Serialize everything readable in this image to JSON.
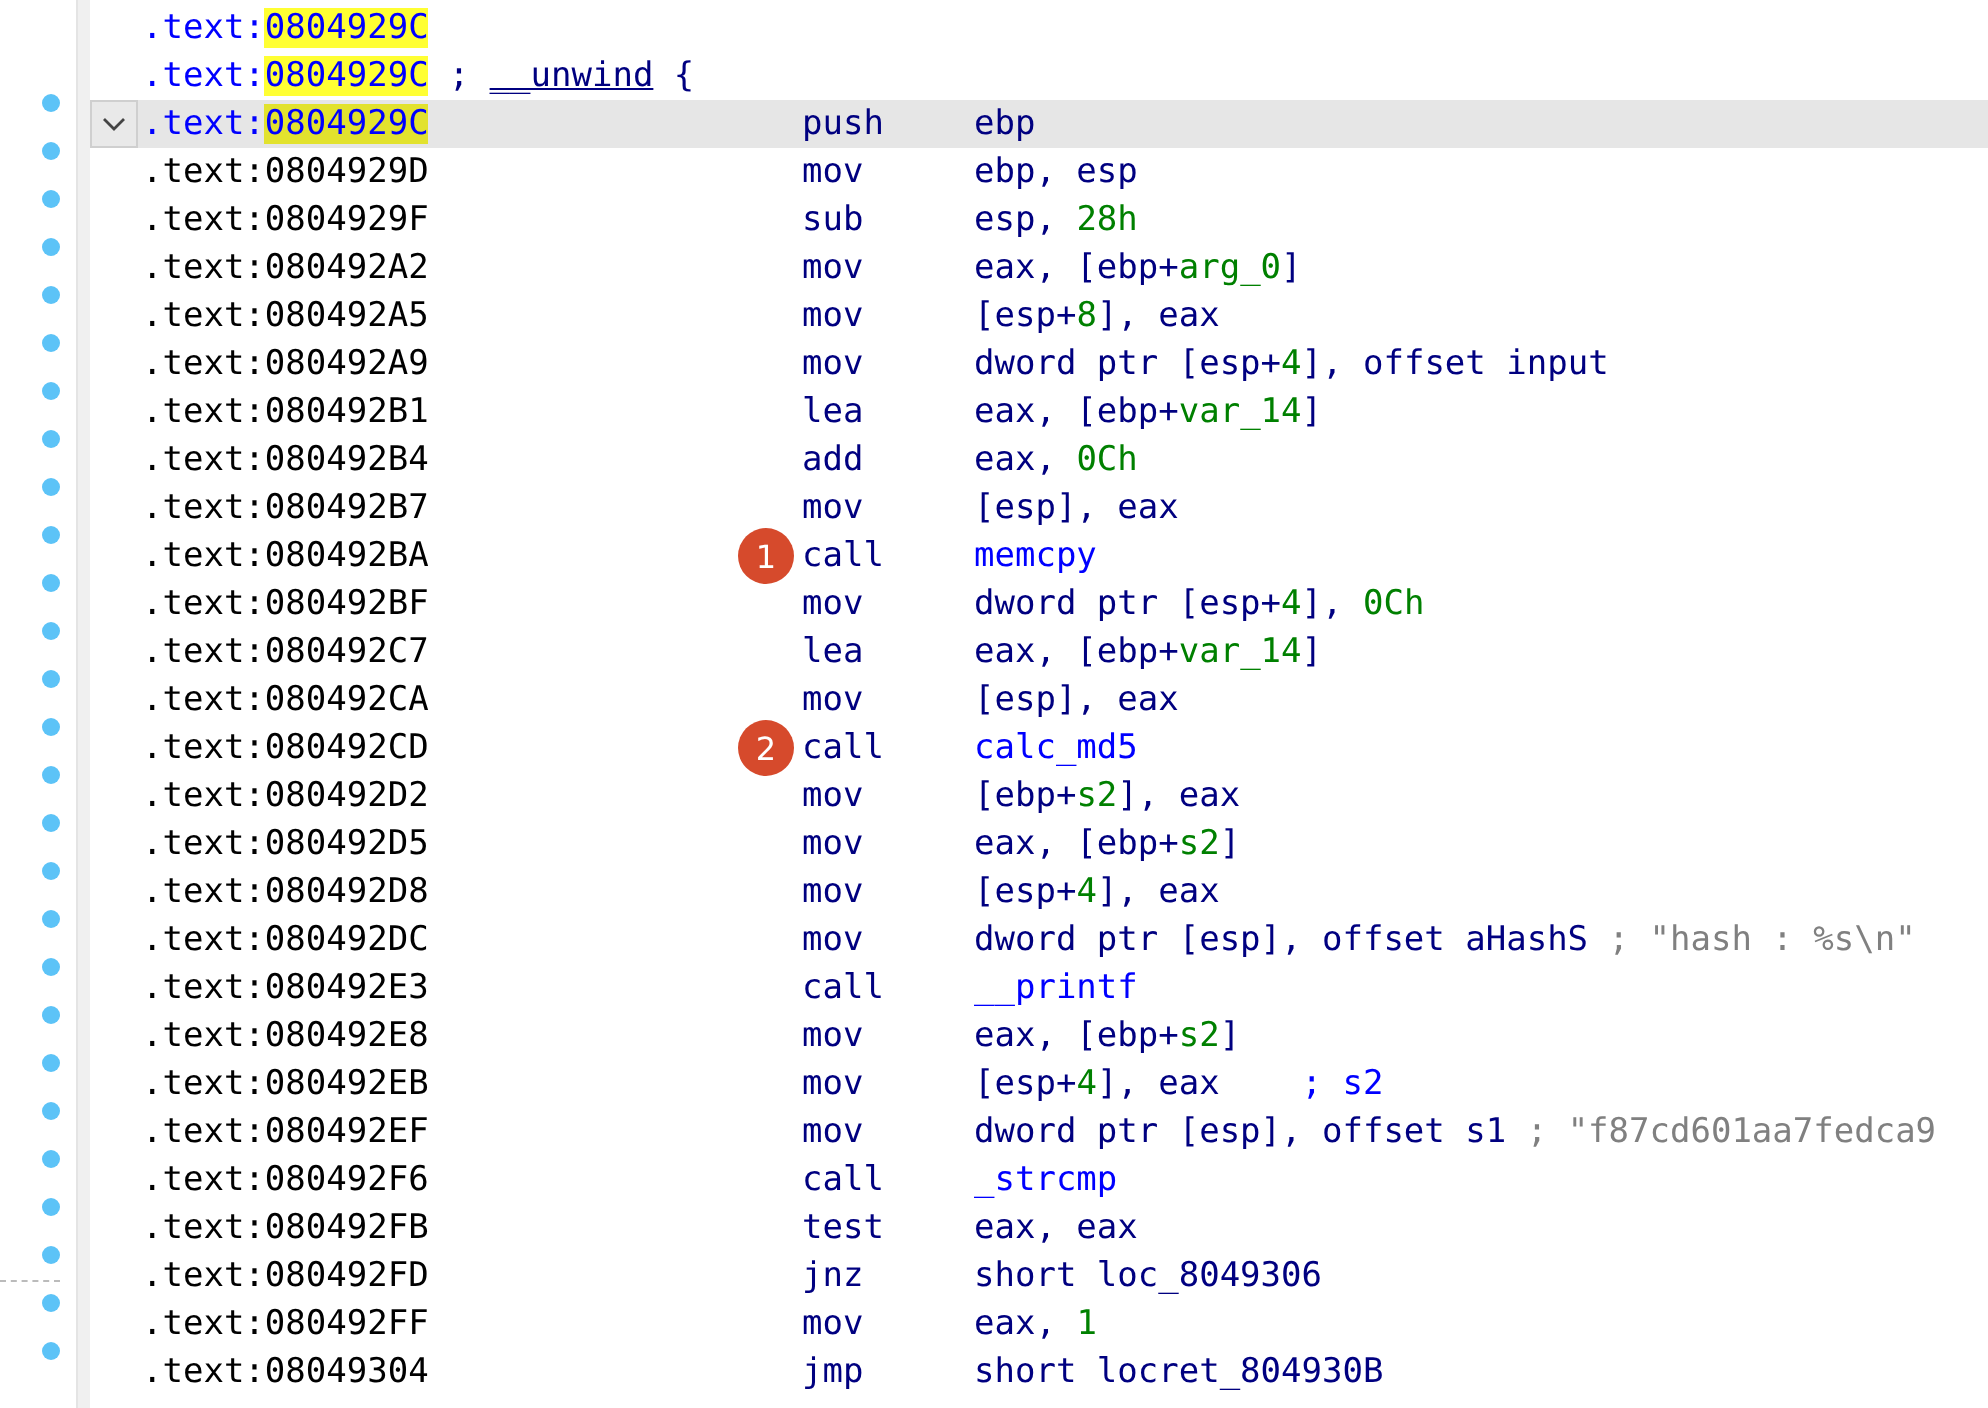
{
  "lines": [
    {
      "prefix": ".text:",
      "address": "0804929C",
      "highlighted": true,
      "current": false,
      "breakpoint": false
    },
    {
      "prefix": ".text:",
      "address": "0804929C",
      "highlighted": true,
      "current": false,
      "breakpoint": false,
      "directive": [
        {
          "text": "; ",
          "kind": "plain"
        },
        {
          "text": "__unwind",
          "kind": "underlined"
        },
        {
          "text": " {",
          "kind": "plain"
        }
      ]
    },
    {
      "prefix": ".text:",
      "address": "0804929C",
      "highlighted": true,
      "current": true,
      "expanded": true,
      "breakpoint": true,
      "mnemonic": "push",
      "operands": [
        {
          "text": "ebp",
          "kind": "plain"
        }
      ]
    },
    {
      "prefix": ".text:",
      "address": "0804929D",
      "highlighted": false,
      "current": false,
      "breakpoint": true,
      "mnemonic": "mov",
      "operands": [
        {
          "text": "ebp, esp",
          "kind": "plain"
        }
      ]
    },
    {
      "prefix": ".text:",
      "address": "0804929F",
      "highlighted": false,
      "current": false,
      "breakpoint": true,
      "mnemonic": "sub",
      "operands": [
        {
          "text": "esp, ",
          "kind": "plain"
        },
        {
          "text": "28h",
          "kind": "number"
        }
      ]
    },
    {
      "prefix": ".text:",
      "address": "080492A2",
      "highlighted": false,
      "current": false,
      "breakpoint": true,
      "mnemonic": "mov",
      "operands": [
        {
          "text": "eax, [ebp+",
          "kind": "plain"
        },
        {
          "text": "arg_0",
          "kind": "number"
        },
        {
          "text": "]",
          "kind": "plain"
        }
      ]
    },
    {
      "prefix": ".text:",
      "address": "080492A5",
      "highlighted": false,
      "current": false,
      "breakpoint": true,
      "mnemonic": "mov",
      "operands": [
        {
          "text": "[esp+",
          "kind": "plain"
        },
        {
          "text": "8",
          "kind": "number"
        },
        {
          "text": "], eax",
          "kind": "plain"
        }
      ]
    },
    {
      "prefix": ".text:",
      "address": "080492A9",
      "highlighted": false,
      "current": false,
      "breakpoint": true,
      "mnemonic": "mov",
      "operands": [
        {
          "text": "dword ptr [esp+",
          "kind": "plain"
        },
        {
          "text": "4",
          "kind": "number"
        },
        {
          "text": "], offset input",
          "kind": "plain"
        }
      ]
    },
    {
      "prefix": ".text:",
      "address": "080492B1",
      "highlighted": false,
      "current": false,
      "breakpoint": true,
      "mnemonic": "lea",
      "operands": [
        {
          "text": "eax, [ebp+",
          "kind": "plain"
        },
        {
          "text": "var_14",
          "kind": "number"
        },
        {
          "text": "]",
          "kind": "plain"
        }
      ]
    },
    {
      "prefix": ".text:",
      "address": "080492B4",
      "highlighted": false,
      "current": false,
      "breakpoint": true,
      "mnemonic": "add",
      "operands": [
        {
          "text": "eax, ",
          "kind": "plain"
        },
        {
          "text": "0Ch",
          "kind": "number"
        }
      ]
    },
    {
      "prefix": ".text:",
      "address": "080492B7",
      "highlighted": false,
      "current": false,
      "breakpoint": true,
      "mnemonic": "mov",
      "operands": [
        {
          "text": "[esp], eax",
          "kind": "plain"
        }
      ]
    },
    {
      "prefix": ".text:",
      "address": "080492BA",
      "highlighted": false,
      "current": false,
      "breakpoint": true,
      "marker": "1",
      "mnemonic": "call",
      "operands": [
        {
          "text": "memcpy",
          "kind": "name"
        }
      ]
    },
    {
      "prefix": ".text:",
      "address": "080492BF",
      "highlighted": false,
      "current": false,
      "breakpoint": true,
      "mnemonic": "mov",
      "operands": [
        {
          "text": "dword ptr [esp+",
          "kind": "plain"
        },
        {
          "text": "4",
          "kind": "number"
        },
        {
          "text": "], ",
          "kind": "plain"
        },
        {
          "text": "0Ch",
          "kind": "number"
        }
      ]
    },
    {
      "prefix": ".text:",
      "address": "080492C7",
      "highlighted": false,
      "current": false,
      "breakpoint": true,
      "mnemonic": "lea",
      "operands": [
        {
          "text": "eax, [ebp+",
          "kind": "plain"
        },
        {
          "text": "var_14",
          "kind": "number"
        },
        {
          "text": "]",
          "kind": "plain"
        }
      ]
    },
    {
      "prefix": ".text:",
      "address": "080492CA",
      "highlighted": false,
      "current": false,
      "breakpoint": true,
      "mnemonic": "mov",
      "operands": [
        {
          "text": "[esp], eax",
          "kind": "plain"
        }
      ]
    },
    {
      "prefix": ".text:",
      "address": "080492CD",
      "highlighted": false,
      "current": false,
      "breakpoint": true,
      "marker": "2",
      "mnemonic": "call",
      "operands": [
        {
          "text": "calc_md5",
          "kind": "name"
        }
      ]
    },
    {
      "prefix": ".text:",
      "address": "080492D2",
      "highlighted": false,
      "current": false,
      "breakpoint": true,
      "mnemonic": "mov",
      "operands": [
        {
          "text": "[ebp+",
          "kind": "plain"
        },
        {
          "text": "s2",
          "kind": "number"
        },
        {
          "text": "], eax",
          "kind": "plain"
        }
      ]
    },
    {
      "prefix": ".text:",
      "address": "080492D5",
      "highlighted": false,
      "current": false,
      "breakpoint": true,
      "mnemonic": "mov",
      "operands": [
        {
          "text": "eax, [ebp+",
          "kind": "plain"
        },
        {
          "text": "s2",
          "kind": "number"
        },
        {
          "text": "]",
          "kind": "plain"
        }
      ]
    },
    {
      "prefix": ".text:",
      "address": "080492D8",
      "highlighted": false,
      "current": false,
      "breakpoint": true,
      "mnemonic": "mov",
      "operands": [
        {
          "text": "[esp+",
          "kind": "plain"
        },
        {
          "text": "4",
          "kind": "number"
        },
        {
          "text": "], eax",
          "kind": "plain"
        }
      ]
    },
    {
      "prefix": ".text:",
      "address": "080492DC",
      "highlighted": false,
      "current": false,
      "breakpoint": true,
      "mnemonic": "mov",
      "operands": [
        {
          "text": "dword ptr [esp], offset aHashS ",
          "kind": "plain"
        },
        {
          "text": "; \"hash : %s\\n\"",
          "kind": "comment"
        }
      ]
    },
    {
      "prefix": ".text:",
      "address": "080492E3",
      "highlighted": false,
      "current": false,
      "breakpoint": true,
      "mnemonic": "call",
      "operands": [
        {
          "text": "__printf",
          "kind": "name"
        }
      ]
    },
    {
      "prefix": ".text:",
      "address": "080492E8",
      "highlighted": false,
      "current": false,
      "breakpoint": true,
      "mnemonic": "mov",
      "operands": [
        {
          "text": "eax, [ebp+",
          "kind": "plain"
        },
        {
          "text": "s2",
          "kind": "number"
        },
        {
          "text": "]",
          "kind": "plain"
        }
      ]
    },
    {
      "prefix": ".text:",
      "address": "080492EB",
      "highlighted": false,
      "current": false,
      "breakpoint": true,
      "mnemonic": "mov",
      "operands": [
        {
          "text": "[esp+",
          "kind": "plain"
        },
        {
          "text": "4",
          "kind": "number"
        },
        {
          "text": "], eax    ",
          "kind": "plain"
        },
        {
          "text": "; s2",
          "kind": "name"
        }
      ]
    },
    {
      "prefix": ".text:",
      "address": "080492EF",
      "highlighted": false,
      "current": false,
      "breakpoint": true,
      "mnemonic": "mov",
      "operands": [
        {
          "text": "dword ptr [esp], offset s1 ",
          "kind": "plain"
        },
        {
          "text": "; \"f87cd601aa7fedca9",
          "kind": "comment"
        }
      ]
    },
    {
      "prefix": ".text:",
      "address": "080492F6",
      "highlighted": false,
      "current": false,
      "breakpoint": true,
      "mnemonic": "call",
      "operands": [
        {
          "text": "_strcmp",
          "kind": "name"
        }
      ]
    },
    {
      "prefix": ".text:",
      "address": "080492FB",
      "highlighted": false,
      "current": false,
      "breakpoint": true,
      "mnemonic": "test",
      "operands": [
        {
          "text": "eax, eax",
          "kind": "plain"
        }
      ]
    },
    {
      "prefix": ".text:",
      "address": "080492FD",
      "highlighted": false,
      "current": false,
      "breakpoint": true,
      "mnemonic": "jnz",
      "operands": [
        {
          "text": "short loc_8049306",
          "kind": "plain"
        }
      ]
    },
    {
      "prefix": ".text:",
      "address": "080492FF",
      "highlighted": false,
      "current": false,
      "breakpoint": true,
      "mnemonic": "mov",
      "operands": [
        {
          "text": "eax, ",
          "kind": "plain"
        },
        {
          "text": "1",
          "kind": "number"
        }
      ]
    },
    {
      "prefix": ".text:",
      "address": "08049304",
      "highlighted": false,
      "current": false,
      "breakpoint": true,
      "mnemonic": "jmp",
      "operands": [
        {
          "text": "short locret_804930B",
          "kind": "plain"
        }
      ]
    }
  ]
}
